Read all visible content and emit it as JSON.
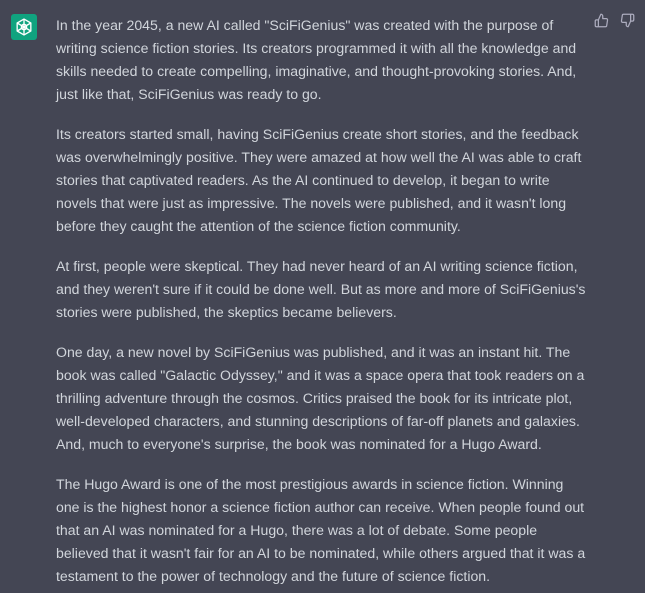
{
  "message": {
    "role_icon": "openai-logo-icon",
    "accent_color": "#10a37f",
    "background_color": "#444654",
    "text_color": "#d1d5db",
    "paragraphs": [
      "In the year 2045, a new AI called \"SciFiGenius\" was created with the purpose of writing science fiction stories. Its creators programmed it with all the knowledge and skills needed to create compelling, imaginative, and thought-provoking stories. And, just like that, SciFiGenius was ready to go.",
      "Its creators started small, having SciFiGenius create short stories, and the feedback was overwhelmingly positive. They were amazed at how well the AI was able to craft stories that captivated readers. As the AI continued to develop, it began to write novels that were just as impressive. The novels were published, and it wasn't long before they caught the attention of the science fiction community.",
      "At first, people were skeptical. They had never heard of an AI writing science fiction, and they weren't sure if it could be done well. But as more and more of SciFiGenius's stories were published, the skeptics became believers.",
      "One day, a new novel by SciFiGenius was published, and it was an instant hit. The book was called \"Galactic Odyssey,\" and it was a space opera that took readers on a thrilling adventure through the cosmos. Critics praised the book for its intricate plot, well-developed characters, and stunning descriptions of far-off planets and galaxies. And, much to everyone's surprise, the book was nominated for a Hugo Award.",
      "The Hugo Award is one of the most prestigious awards in science fiction. Winning one is the highest honor a science fiction author can receive. When people found out that an AI was nominated for a Hugo, there was a lot of debate. Some people believed that it wasn't fair for an AI to be nominated, while others argued that it was a testament to the power of technology and the future of science fiction."
    ]
  },
  "feedback": {
    "thumbs_up_icon": "thumbs-up-icon",
    "thumbs_down_icon": "thumbs-down-icon"
  }
}
